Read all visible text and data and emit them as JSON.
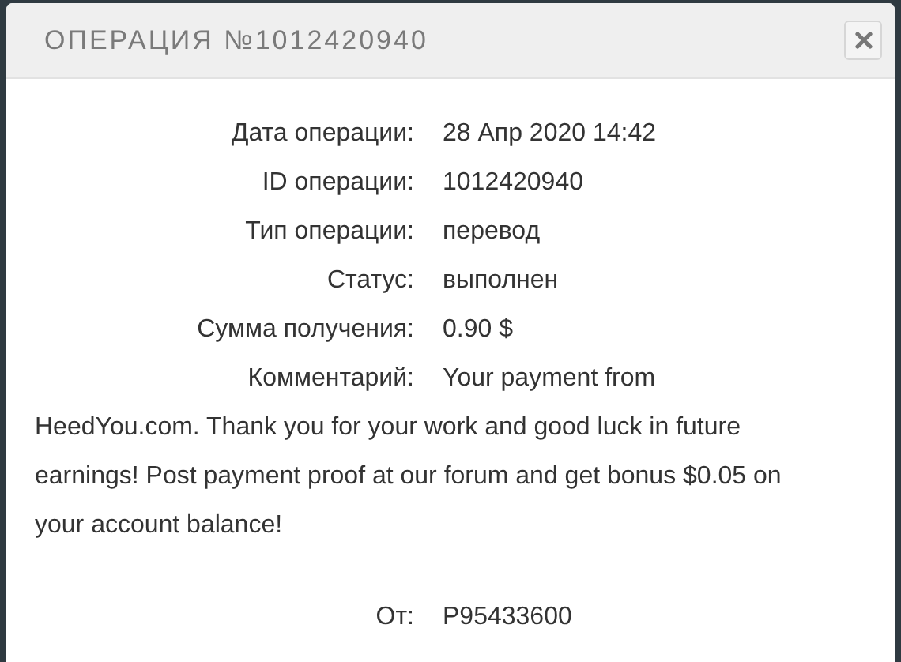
{
  "dialog": {
    "title": "ОПЕРАЦИЯ №1012420940"
  },
  "details": [
    {
      "label": "Дата операции:",
      "value": "28 Апр 2020 14:42"
    },
    {
      "label": "ID операции:",
      "value": "1012420940"
    },
    {
      "label": "Тип операции:",
      "value": "перевод"
    },
    {
      "label": "Статус:",
      "value": "выполнен"
    },
    {
      "label": "Сумма получения:",
      "value": "0.90 $"
    },
    {
      "label": "Комментарий:",
      "value": "Your payment from HeedYou.com. Thank you for your work and good luck in future earnings! Post payment proof at our forum and get bonus $0.05 on your account balance!"
    }
  ],
  "sender": {
    "label": "От:",
    "value": "P95433600"
  }
}
